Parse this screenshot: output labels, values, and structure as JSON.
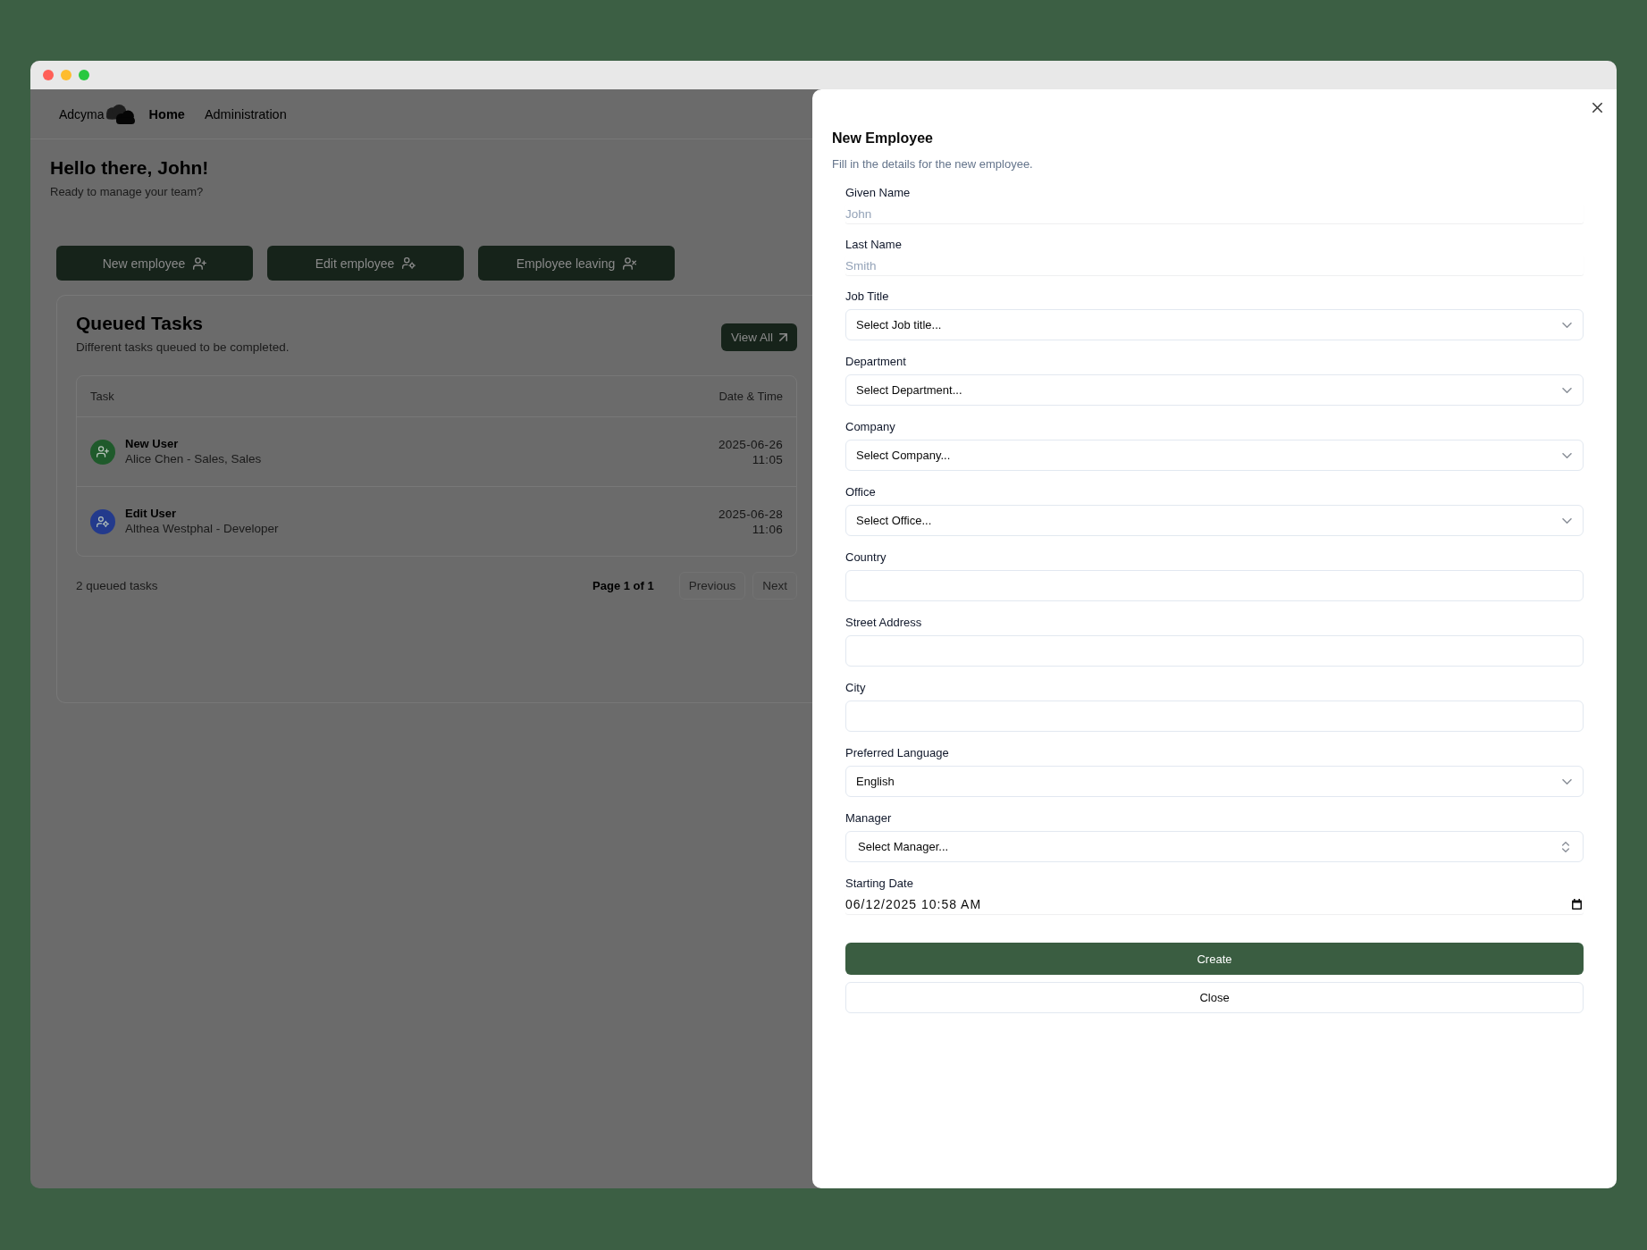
{
  "nav": {
    "logo": "Adcyma",
    "links": [
      {
        "label": "Home",
        "selected": true
      },
      {
        "label": "Administration",
        "selected": false
      }
    ]
  },
  "greeting": {
    "title": "Hello there, John!",
    "subtitle": "Ready to manage your team?"
  },
  "actions": [
    {
      "label": "New employee",
      "kind": "add"
    },
    {
      "label": "Edit employee",
      "kind": "edit"
    },
    {
      "label": "Employee leaving",
      "kind": "remove"
    }
  ],
  "tasks": {
    "title": "Queued Tasks",
    "subtitle": "Different tasks queued to be completed.",
    "view_all": "View All",
    "columns": [
      "Task",
      "Date & Time"
    ],
    "rows": [
      {
        "kind": "add",
        "color": "#1f5a2b",
        "title": "New User",
        "detail": "Alice Chen - Sales, Sales",
        "date": "2025-06-26",
        "time": "11:05"
      },
      {
        "kind": "edit",
        "color": "#233a8c",
        "title": "Edit User",
        "detail": "Althea Westphal - Developer",
        "date": "2025-06-28",
        "time": "11:06"
      }
    ],
    "count": "2 queued tasks",
    "page": "Page 1 of 1",
    "pager": [
      {
        "label": "Previous",
        "disabled": true
      },
      {
        "label": "Next",
        "disabled": true
      }
    ]
  },
  "dialog": {
    "title": "New Employee",
    "description": "Fill in the details for the new employee.",
    "fields": [
      {
        "label": "Given Name",
        "kind": "text",
        "placeholder": "John"
      },
      {
        "label": "Last Name",
        "kind": "text",
        "placeholder": "Smith"
      },
      {
        "label": "Job Title",
        "kind": "select",
        "placeholder": "Select Job title..."
      },
      {
        "label": "Department",
        "kind": "select",
        "placeholder": "Select Department..."
      },
      {
        "label": "Company",
        "kind": "select",
        "placeholder": "Select Company..."
      },
      {
        "label": "Office",
        "kind": "select",
        "placeholder": "Select Office..."
      },
      {
        "label": "Country",
        "kind": "input"
      },
      {
        "label": "Street Address",
        "kind": "input"
      },
      {
        "label": "City",
        "kind": "input"
      },
      {
        "label": "Preferred Language",
        "kind": "select",
        "value": "English"
      },
      {
        "label": "Manager",
        "kind": "combobox",
        "placeholder": "Select Manager..."
      },
      {
        "label": "Starting Date",
        "kind": "datetime",
        "value": "06/12/2025 10:58 AM"
      }
    ],
    "buttons": [
      {
        "label": "Create",
        "kind": "primary"
      },
      {
        "label": "Close",
        "kind": "secondary"
      }
    ]
  }
}
